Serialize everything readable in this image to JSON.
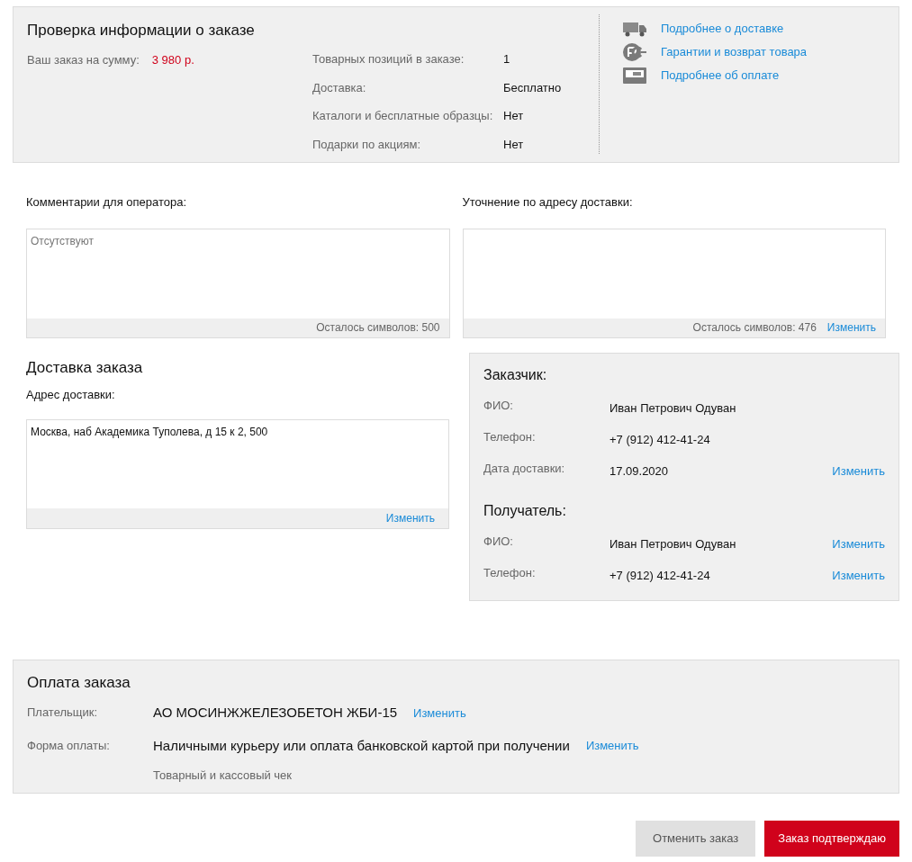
{
  "summary": {
    "title": "Проверка информации о заказе",
    "total_label": "Ваш заказ на сумму:",
    "total_value": "3 980 р.",
    "rows": [
      {
        "label": "Товарных позиций в заказе:",
        "value": "1"
      },
      {
        "label": "Доставка:",
        "value": "Бесплатно"
      },
      {
        "label": "Каталоги и бесплатные образцы:",
        "value": "Нет"
      },
      {
        "label": "Подарки по акциям:",
        "value": "Нет"
      }
    ],
    "links": [
      {
        "kind": "truck",
        "label": "Подробнее о доставке"
      },
      {
        "kind": "certificate",
        "label": "Гарантии и возврат товара"
      },
      {
        "kind": "card",
        "label": "Подробнее об оплате"
      }
    ]
  },
  "comments": [
    {
      "label": "Комментарии для оператора:",
      "placeholder": "Отсутствуют",
      "counter": "Осталось символов: 500"
    },
    {
      "label": "Уточнение по адресу доставки:",
      "counter": "Осталось символов: 476",
      "edit": "Изменить"
    }
  ],
  "delivery": {
    "title": "Доставка заказа",
    "address_label": "Адрес доставки:",
    "address": "Москва, наб Академика Туполева, д 15 к 2, 500",
    "edit": "Изменить"
  },
  "contacts": [
    {
      "title": "Заказчик:",
      "rows": [
        {
          "label": "ФИО:",
          "value": "Иван Петрович Одуван"
        },
        {
          "label": "Телефон:",
          "value": "+7 (912) 412-41-24"
        },
        {
          "label": "Дата доставки:",
          "value": "17.09.2020",
          "edit": "Изменить"
        }
      ]
    },
    {
      "title": "Получатель:",
      "rows": [
        {
          "label": "ФИО:",
          "value": "Иван Петрович Одуван",
          "edit": "Изменить"
        },
        {
          "label": "Телефон:",
          "value": "+7 (912) 412-41-24",
          "edit": "Изменить"
        }
      ]
    }
  ],
  "payment": {
    "title": "Оплата заказа",
    "rows": [
      {
        "label": "Плательщик:",
        "value": "АО МОСИНЖЖЕЛЕЗОБЕТОН ЖБИ-15",
        "edit": "Изменить"
      },
      {
        "label": "Форма оплаты:",
        "value": "Наличными курьеру или оплата банковской картой при получении",
        "edit": "Изменить",
        "note": "Товарный и кассовый чек"
      }
    ]
  },
  "buttons": [
    {
      "kind": "secondary",
      "label": "Отменить заказ"
    },
    {
      "kind": "primary",
      "label": "Заказ подтверждаю"
    }
  ]
}
